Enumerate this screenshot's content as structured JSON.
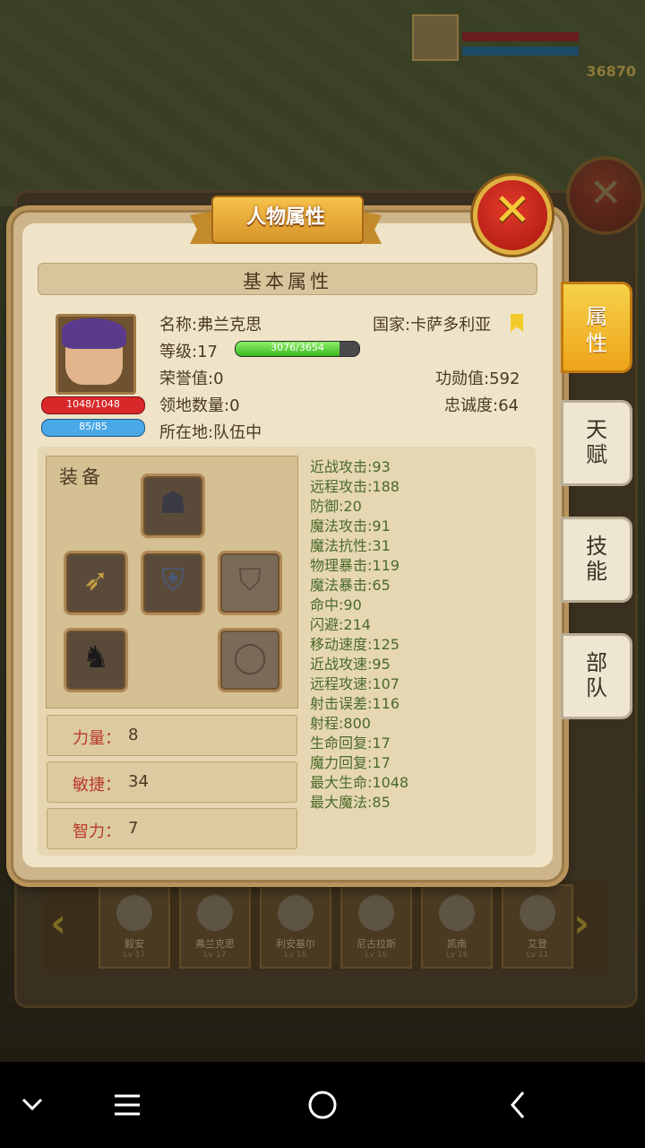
{
  "dialog": {
    "title": "人物属性",
    "section_title": "基本属性"
  },
  "character": {
    "name": "名称:弗兰克思",
    "country": "国家:卡萨多利亚",
    "level": "等级:17",
    "xp_text": "3076/3654",
    "xp_fraction": 0.84,
    "honor": "荣誉值:0",
    "merit": "功勋值:592",
    "territories": "领地数量:0",
    "loyalty": "忠诚度:64",
    "location": "所在地:队伍中",
    "hp_text": "1048/1048",
    "mp_text": "85/85"
  },
  "equipment": {
    "label": "装备",
    "slots": [
      {
        "name": "hood",
        "icon": "hood-icon"
      },
      {
        "name": "bow",
        "icon": "bow-icon"
      },
      {
        "name": "armor",
        "icon": "armor-icon"
      },
      {
        "name": "shield",
        "icon": "shield-icon",
        "empty": true
      },
      {
        "name": "horse",
        "icon": "horse-icon"
      },
      {
        "name": "ring",
        "icon": "ring-icon",
        "empty": true
      }
    ]
  },
  "attributes": [
    {
      "label": "力量：",
      "value": "8"
    },
    {
      "label": "敏捷：",
      "value": "34"
    },
    {
      "label": "智力：",
      "value": "7"
    }
  ],
  "stats": [
    "近战攻击:93",
    "远程攻击:188",
    "防御:20",
    "魔法攻击:91",
    "魔法抗性:31",
    "物理暴击:119",
    "魔法暴击:65",
    "命中:90",
    "闪避:214",
    "移动速度:125",
    "近战攻速:95",
    "远程攻速:107",
    "射击误差:116",
    "射程:800",
    "生命回复:17",
    "魔力回复:17",
    "最大生命:1048",
    "最大魔法:85"
  ],
  "side_tabs": [
    {
      "top": "属",
      "bottom": "性",
      "active": true
    },
    {
      "top": "天",
      "bottom": "赋",
      "active": false
    },
    {
      "top": "技",
      "bottom": "能",
      "active": false
    },
    {
      "top": "部",
      "bottom": "队",
      "active": false
    }
  ],
  "roster": [
    {
      "name": "毅安",
      "level": "Lv 17"
    },
    {
      "name": "弗兰克思",
      "level": "Lv 17"
    },
    {
      "name": "利安基尔",
      "level": "Lv 16"
    },
    {
      "name": "尼古拉斯",
      "level": "Lv 16"
    },
    {
      "name": "凯南",
      "level": "Lv 16"
    },
    {
      "name": "艾登",
      "level": "Lv 11"
    }
  ],
  "background": {
    "gold": "36870"
  },
  "colors": {
    "accent": "#f2b62a",
    "panel": "#efe4c8",
    "stat_text": "#4a6a2a",
    "attr_label": "#b83a2a"
  }
}
